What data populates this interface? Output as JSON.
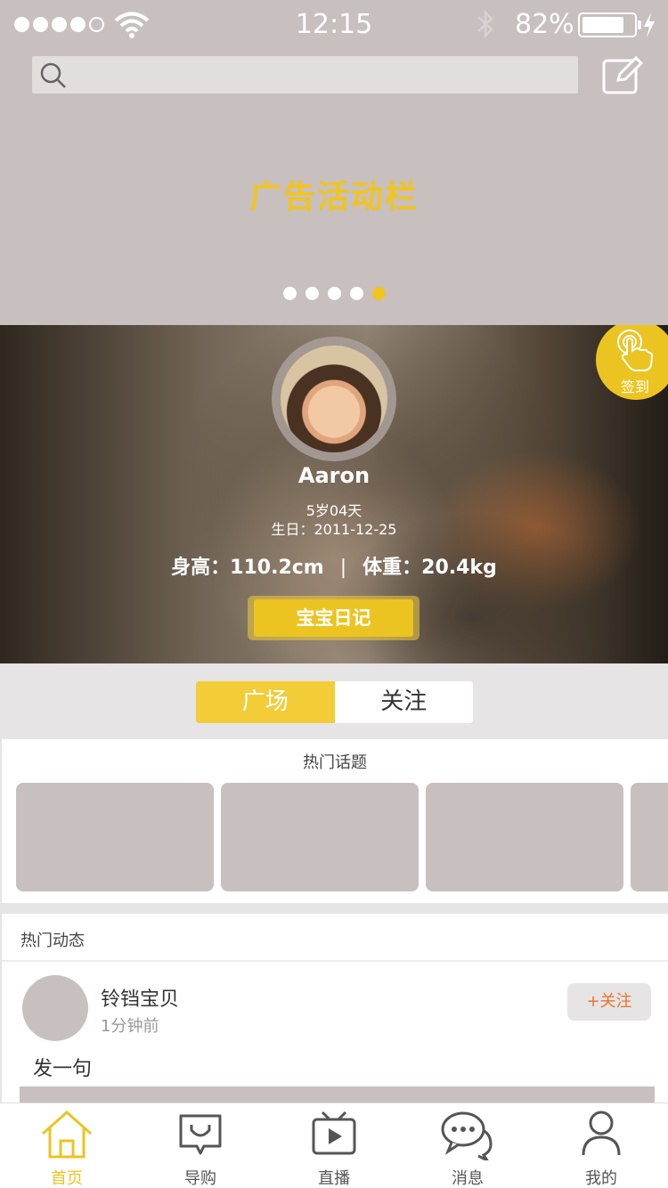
{
  "status_bar": {
    "time": "12:15",
    "battery": "82%"
  },
  "search": {
    "placeholder": ""
  },
  "banner": {
    "title": "广告活动栏",
    "dot_count": 5,
    "active_dot": 4
  },
  "profile": {
    "name": "Aaron",
    "age": "5岁04天",
    "birthday": "生日：2011-12-25",
    "height": "身高：110.2cm",
    "separator": "|",
    "weight": "体重：20.4kg",
    "diary_button": "宝宝日记",
    "checkin_label": "签到"
  },
  "tabs": [
    {
      "label": "广场",
      "active": true
    },
    {
      "label": "关注",
      "active": false
    }
  ],
  "topics": {
    "title": "热门话题"
  },
  "feed": {
    "title": "热门动态",
    "posts": [
      {
        "user": "铃铛宝贝",
        "time": "1分钟前",
        "follow": "+关注",
        "text": "发一句"
      }
    ]
  },
  "nav": [
    {
      "label": "首页",
      "icon": "home-icon",
      "active": true
    },
    {
      "label": "导购",
      "icon": "shopping-guide-icon",
      "active": false
    },
    {
      "label": "直播",
      "icon": "live-tv-icon",
      "active": false
    },
    {
      "label": "消息",
      "icon": "message-icon",
      "active": false
    },
    {
      "label": "我的",
      "icon": "profile-icon",
      "active": false
    }
  ],
  "colors": {
    "accent": "#ecc421",
    "placeholder": "#c8bfbf",
    "follow_text": "#e8752f"
  }
}
